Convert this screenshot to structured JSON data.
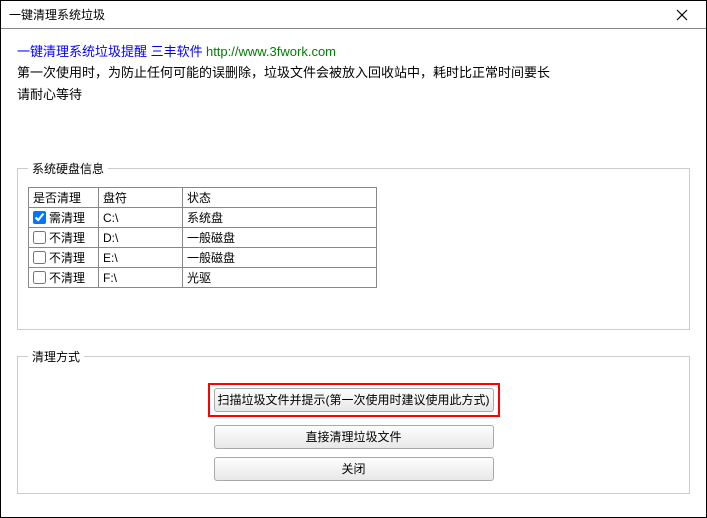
{
  "window": {
    "title": "一键清理系统垃圾"
  },
  "header": {
    "blue_text": "一键清理系统垃圾提醒 三丰软件",
    "green_url": "http://www.3fwork.com",
    "desc1": "第一次使用时，为防止任何可能的误删除，垃圾文件会被放入回收站中，耗时比正常时间要长",
    "desc2": "请耐心等待"
  },
  "disk_info": {
    "legend": "系统硬盘信息",
    "headers": {
      "check": "是否清理",
      "drive": "盘符",
      "status": "状态"
    },
    "rows": [
      {
        "checked": true,
        "label": "需清理",
        "drive": "C:\\",
        "status": "系统盘"
      },
      {
        "checked": false,
        "label": "不清理",
        "drive": "D:\\",
        "status": "一般磁盘"
      },
      {
        "checked": false,
        "label": "不清理",
        "drive": "E:\\",
        "status": "一般磁盘"
      },
      {
        "checked": false,
        "label": "不清理",
        "drive": "F:\\",
        "status": "光驱"
      }
    ]
  },
  "clean_mode": {
    "legend": "清理方式",
    "scan_btn": "扫描垃圾文件并提示(第一次使用时建议使用此方式)",
    "direct_btn": "直接清理垃圾文件",
    "close_btn": "关闭"
  }
}
